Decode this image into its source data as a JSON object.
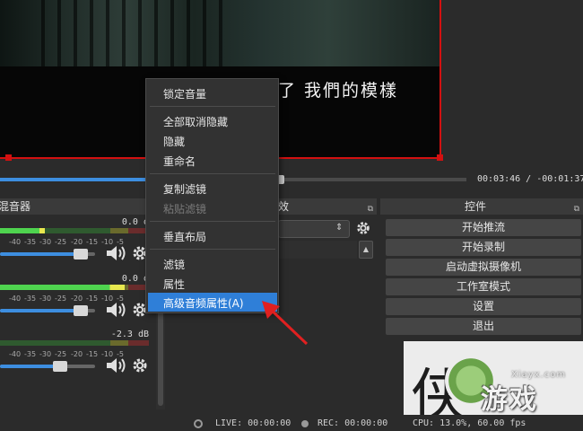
{
  "preview": {
    "subtitle": "了 我們的模樣",
    "timecode": "00:03:46 / -00:01:37"
  },
  "mixer": {
    "title": "混音器",
    "channels": [
      {
        "db": "0.0 d",
        "level": 0.3,
        "volume": 0.85
      },
      {
        "db": "0.0 d",
        "level": 0.84,
        "volume": 0.85
      },
      {
        "db": "-2.3 dB",
        "level": 0.0,
        "volume": 0.63
      }
    ],
    "ticks": [
      "-40",
      "-35",
      "-30",
      "-25",
      "-20",
      "-15",
      "-10",
      "-5"
    ]
  },
  "filters_dock": {
    "title": "效"
  },
  "controls": {
    "title": "控件",
    "buttons": [
      "开始推流",
      "开始录制",
      "启动虚拟摄像机",
      "工作室模式",
      "设置",
      "退出"
    ]
  },
  "context_menu": {
    "items": [
      {
        "label": "锁定音量",
        "enabled": true
      },
      {
        "label": "全部取消隐藏",
        "enabled": true
      },
      {
        "label": "隐藏",
        "enabled": true
      },
      {
        "label": "重命名",
        "enabled": true
      },
      {
        "label": "复制滤镜",
        "enabled": true
      },
      {
        "label": "粘贴滤镜",
        "enabled": false
      },
      {
        "label": "垂直布局",
        "enabled": true
      },
      {
        "label": "滤镜",
        "enabled": true
      },
      {
        "label": "属性",
        "enabled": true
      },
      {
        "label": "高级音频属性(A)",
        "enabled": true,
        "highlighted": true
      }
    ]
  },
  "status_bar": {
    "live": "LIVE: 00:00:00",
    "rec": "REC: 00:00:00",
    "cpu": "CPU: 13.0%, 60.00 fps"
  },
  "watermark": {
    "site": "Xiayx.com",
    "text": "游戏"
  },
  "colors": {
    "accent": "#2f7fd8",
    "selection_border": "#d31010",
    "slider": "#3d8ee0",
    "arrow": "#e02020"
  }
}
